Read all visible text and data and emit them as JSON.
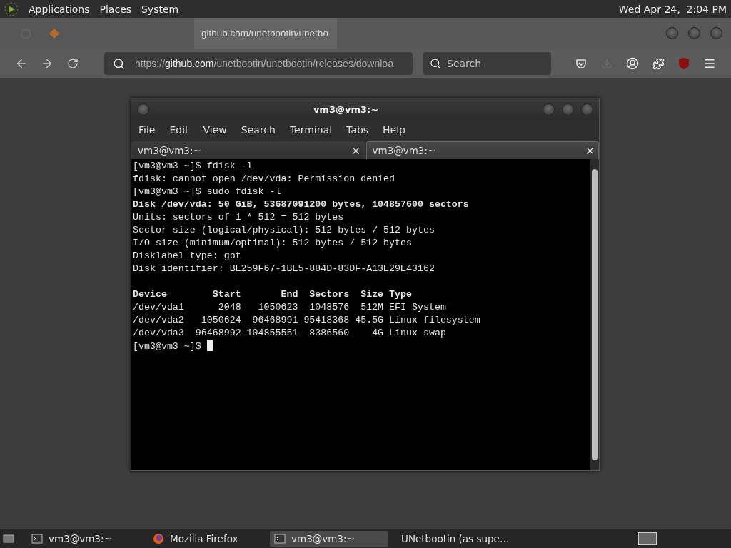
{
  "top_panel": {
    "menus": [
      "Applications",
      "Places",
      "System"
    ],
    "clock": "Wed Apr 24,  2:04 PM"
  },
  "browser": {
    "tabs": [
      {
        "selected": false
      },
      {
        "label": "github.com/unetbootin/unetbo",
        "selected": true
      }
    ],
    "url": {
      "scheme": "https://",
      "host": "github.com",
      "path": "/unetbootin/unetbootin/releases/downloa"
    },
    "search": {
      "placeholder": "Search"
    }
  },
  "terminal": {
    "title": "vm3@vm3:~",
    "menus": [
      "File",
      "Edit",
      "View",
      "Search",
      "Terminal",
      "Tabs",
      "Help"
    ],
    "tabs": [
      {
        "label": "vm3@vm3:~",
        "selected": false
      },
      {
        "label": "vm3@vm3:~",
        "selected": true
      }
    ],
    "lines": [
      {
        "text": "[vm3@vm3 ~]$ fdisk -l",
        "bold": false
      },
      {
        "text": "fdisk: cannot open /dev/vda: Permission denied",
        "bold": false
      },
      {
        "text": "[vm3@vm3 ~]$ sudo fdisk -l",
        "bold": false
      },
      {
        "text": "Disk /dev/vda: 50 GiB, 53687091200 bytes, 104857600 sectors",
        "bold": true
      },
      {
        "text": "Units: sectors of 1 * 512 = 512 bytes",
        "bold": false
      },
      {
        "text": "Sector size (logical/physical): 512 bytes / 512 bytes",
        "bold": false
      },
      {
        "text": "I/O size (minimum/optimal): 512 bytes / 512 bytes",
        "bold": false
      },
      {
        "text": "Disklabel type: gpt",
        "bold": false
      },
      {
        "text": "Disk identifier: BE259F67-1BE5-884D-83DF-A13E29E43162",
        "bold": false
      },
      {
        "text": "Device        Start       End  Sectors  Size Type",
        "bold": true,
        "space_before": true
      },
      {
        "text": "/dev/vda1      2048   1050623  1048576  512M EFI System",
        "bold": false
      },
      {
        "text": "/dev/vda2   1050624  96468991 95418368 45.5G Linux filesystem",
        "bold": false
      },
      {
        "text": "/dev/vda3  96468992 104855551  8386560    4G Linux swap",
        "bold": false
      },
      {
        "text": "[vm3@vm3 ~]$ ",
        "bold": false,
        "cursor": true
      }
    ]
  },
  "taskbar": {
    "items": [
      {
        "kind": "terminal",
        "label": "vm3@vm3:~",
        "selected": false
      },
      {
        "kind": "browser",
        "label": "Mozilla Firefox",
        "selected": false
      },
      {
        "kind": "terminal",
        "label": "vm3@vm3:~",
        "selected": true
      },
      {
        "kind": "window",
        "label": "UNetbootin (as supe…",
        "selected": false
      }
    ]
  }
}
